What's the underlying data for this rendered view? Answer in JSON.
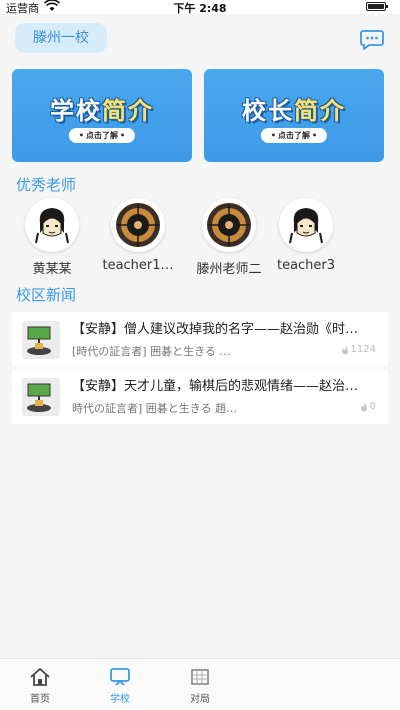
{
  "status_bar": {
    "carrier": "运营商",
    "time": "下午 2:48"
  },
  "header": {
    "school_name": "滕州一校",
    "chat_icon": "chat-bubble-icon"
  },
  "banners": [
    {
      "title_a": "学校",
      "title_b": "简介",
      "tag": "点击了解"
    },
    {
      "title_a": "校长",
      "title_b": "简介",
      "tag": "点击了解"
    }
  ],
  "sections": {
    "teachers_title": "优秀老师",
    "news_title": "校区新闻"
  },
  "teachers": [
    {
      "name": "黄某某",
      "avatar": "cartoon-girl"
    },
    {
      "name": "teacher1…",
      "avatar": "go-board"
    },
    {
      "name": "滕州老师二",
      "avatar": "go-board"
    },
    {
      "name": "teacher3",
      "avatar": "cartoon-girl"
    }
  ],
  "news": [
    {
      "title": "【安静】僧人建议改掉我的名字——赵治勋《时…",
      "subtitle": "[時代の証言者] 囲碁と生きる …",
      "views": "1124"
    },
    {
      "title": "【安静】天才儿童，输棋后的悲观情绪——赵治…",
      "subtitle": "時代の証言者] 囲碁と生きる 趙…",
      "views": "0"
    }
  ],
  "tabbar": [
    {
      "label": "首页",
      "icon": "home-icon"
    },
    {
      "label": "学校",
      "icon": "school-icon"
    },
    {
      "label": "对局",
      "icon": "game-icon"
    }
  ],
  "colors": {
    "accent": "#3a9ae8",
    "banner": "#4aa8ee",
    "pill_bg": "#d6ecfb"
  }
}
